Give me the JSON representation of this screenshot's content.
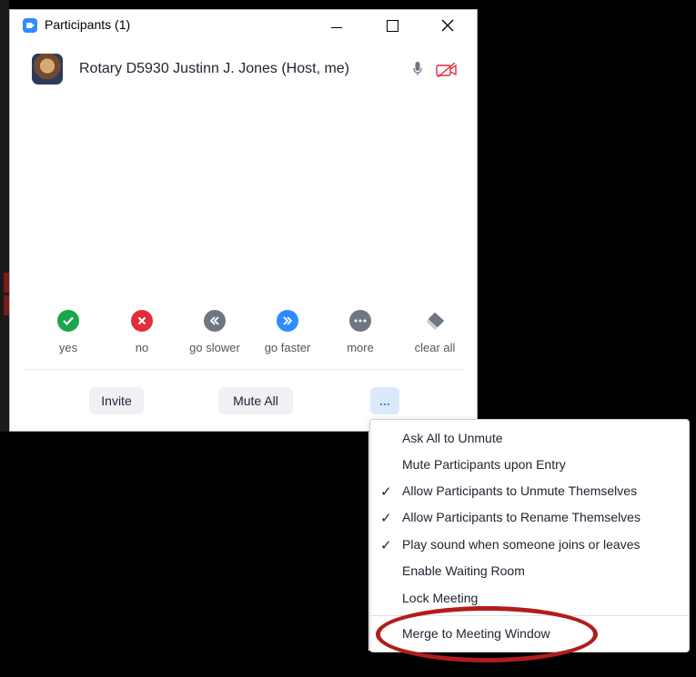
{
  "window": {
    "title": "Participants (1)"
  },
  "participant": {
    "name": "Rotary D5930 Justinn J. Jones (Host, me)"
  },
  "feedback": [
    {
      "label": "yes",
      "color": "#1aa64a",
      "icon": "check-icon"
    },
    {
      "label": "no",
      "color": "#e02f3a",
      "icon": "x-icon"
    },
    {
      "label": "go slower",
      "color": "#6e7781",
      "icon": "rewind-icon"
    },
    {
      "label": "go faster",
      "color": "#2d8cff",
      "icon": "fast-forward-icon"
    },
    {
      "label": "more",
      "color": "#6e7781",
      "icon": "ellipsis-icon"
    },
    {
      "label": "clear all",
      "color": "#6e7781",
      "icon": "eraser-icon"
    }
  ],
  "buttons": {
    "invite": "Invite",
    "mute_all": "Mute All",
    "more": "..."
  },
  "menu": {
    "items": [
      {
        "label": "Ask All to Unmute",
        "checked": false
      },
      {
        "label": "Mute Participants upon Entry",
        "checked": false
      },
      {
        "label": "Allow Participants to Unmute Themselves",
        "checked": true
      },
      {
        "label": "Allow Participants to Rename Themselves",
        "checked": true
      },
      {
        "label": "Play sound when someone joins or leaves",
        "checked": true
      },
      {
        "label": "Enable Waiting Room",
        "checked": false
      },
      {
        "label": "Lock Meeting",
        "checked": false
      },
      {
        "label": "Merge to Meeting Window",
        "checked": false
      }
    ],
    "check_glyph": "✓"
  },
  "colors": {
    "accent": "#2d8cff",
    "highlight": "#b21c1c",
    "video_off": "#e02f3a"
  }
}
